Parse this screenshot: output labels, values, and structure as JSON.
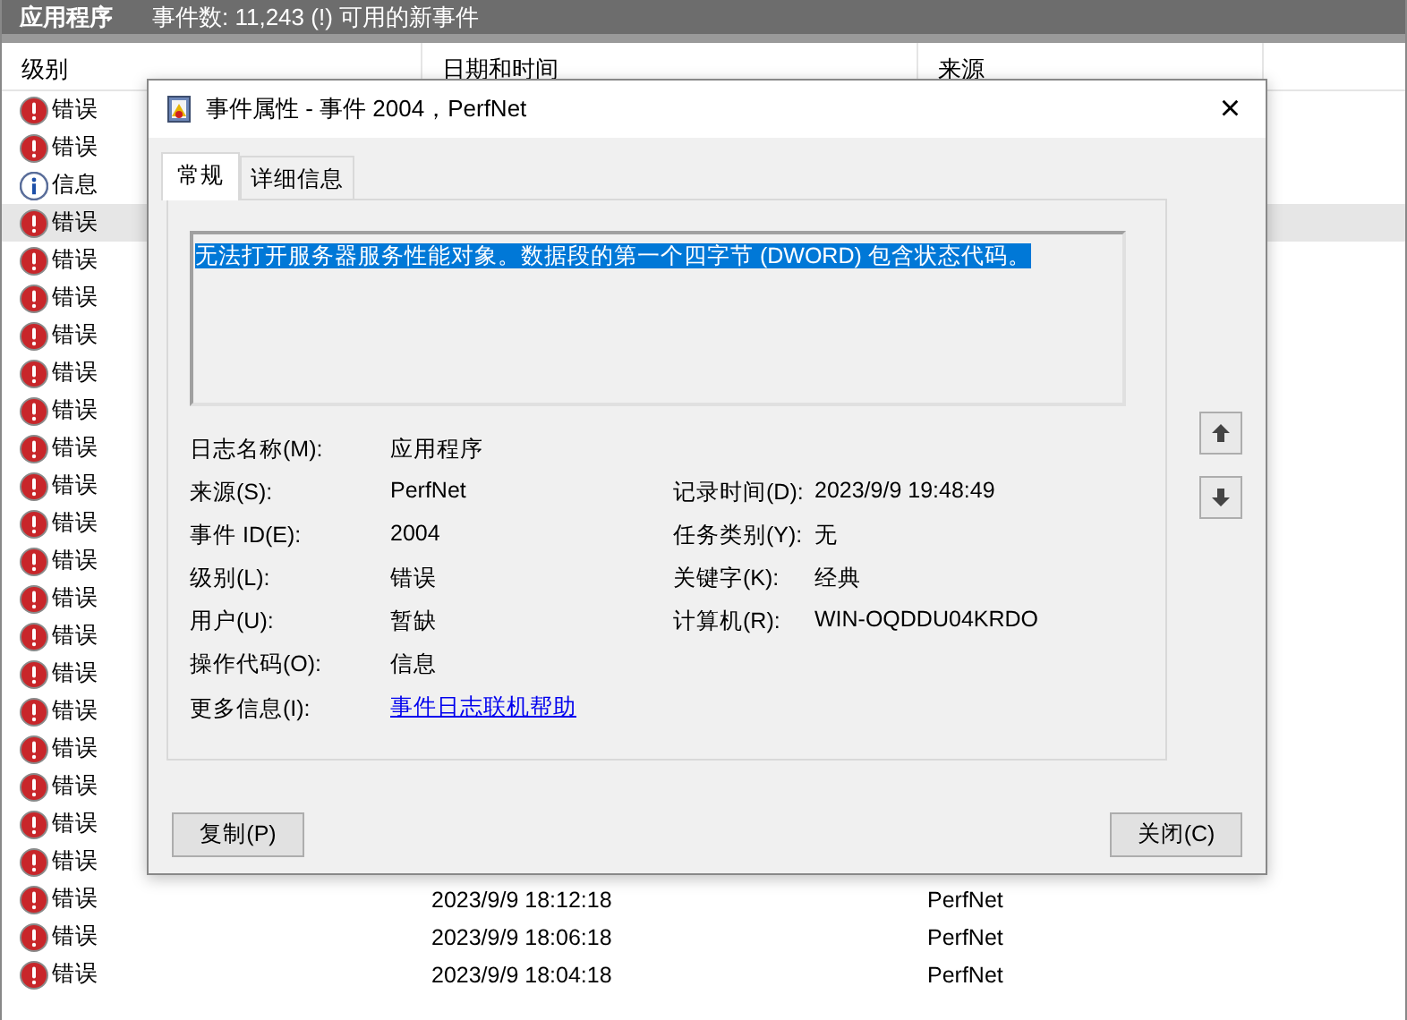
{
  "header": {
    "title": "应用程序",
    "summary": "事件数: 11,243 (!) 可用的新事件"
  },
  "table": {
    "columns": [
      "级别",
      "日期和时间",
      "来源"
    ],
    "rows": [
      {
        "kind": "error",
        "level": "错误",
        "selected": false
      },
      {
        "kind": "error",
        "level": "错误",
        "selected": false
      },
      {
        "kind": "info",
        "level": "信息",
        "selected": false
      },
      {
        "kind": "error",
        "level": "错误",
        "selected": true
      },
      {
        "kind": "error",
        "level": "错误",
        "selected": false
      },
      {
        "kind": "error",
        "level": "错误",
        "selected": false
      },
      {
        "kind": "error",
        "level": "错误",
        "selected": false
      },
      {
        "kind": "error",
        "level": "错误",
        "selected": false
      },
      {
        "kind": "error",
        "level": "错误",
        "selected": false
      },
      {
        "kind": "error",
        "level": "错误",
        "selected": false
      },
      {
        "kind": "error",
        "level": "错误",
        "selected": false
      },
      {
        "kind": "error",
        "level": "错误",
        "selected": false
      },
      {
        "kind": "error",
        "level": "错误",
        "selected": false
      },
      {
        "kind": "error",
        "level": "错误",
        "selected": false
      },
      {
        "kind": "error",
        "level": "错误",
        "selected": false
      },
      {
        "kind": "error",
        "level": "错误",
        "selected": false
      },
      {
        "kind": "error",
        "level": "错误",
        "selected": false
      },
      {
        "kind": "error",
        "level": "错误",
        "selected": false
      },
      {
        "kind": "error",
        "level": "错误",
        "selected": false
      },
      {
        "kind": "error",
        "level": "错误",
        "selected": false
      },
      {
        "kind": "error",
        "level": "错误",
        "selected": false
      },
      {
        "kind": "error",
        "level": "错误",
        "selected": false,
        "date": "2023/9/9 18:12:18",
        "source": "PerfNet"
      },
      {
        "kind": "error",
        "level": "错误",
        "selected": false,
        "date": "2023/9/9 18:06:18",
        "source": "PerfNet"
      },
      {
        "kind": "error",
        "level": "错误",
        "selected": false,
        "date": "2023/9/9 18:04:18",
        "source": "PerfNet"
      }
    ]
  },
  "dialog": {
    "title": "事件属性 - 事件 2004，PerfNet",
    "close": "×",
    "tabs": [
      {
        "label": "常规",
        "selected": true
      },
      {
        "label": "详细信息",
        "selected": false
      }
    ],
    "description": {
      "text": "无法打开服务器服务性能对象。数据段的第一个四字节 (DWORD) 包含状态代码。",
      "selected": true
    },
    "fields": [
      {
        "label": "日志名称(M):",
        "value": "应用程序"
      },
      {
        "label": "来源(S):",
        "value": "PerfNet",
        "label2": "记录时间(D):",
        "value2": "2023/9/9 19:48:49"
      },
      {
        "label": "事件 ID(E):",
        "value": "2004",
        "label2": "任务类别(Y):",
        "value2": "无"
      },
      {
        "label": "级别(L):",
        "value": "错误",
        "label2": "关键字(K):",
        "value2": "经典"
      },
      {
        "label": "用户(U):",
        "value": "暂缺",
        "label2": "计算机(R):",
        "value2": "WIN-OQDDU04KRDO"
      },
      {
        "label": "操作代码(O):",
        "value": "信息"
      },
      {
        "label": "更多信息(I):",
        "link": "事件日志联机帮助"
      }
    ],
    "buttons": [
      {
        "label": "复制(P)"
      },
      {
        "label": "关闭(C)"
      }
    ]
  }
}
